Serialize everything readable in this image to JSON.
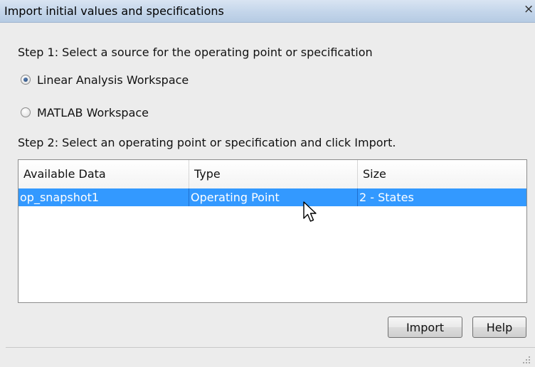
{
  "window": {
    "title": "Import initial values and specifications",
    "close_glyph": "×"
  },
  "step1": {
    "label": "Step 1: Select a source for the operating point or specification",
    "options": [
      {
        "label": "Linear Analysis Workspace",
        "selected": true
      },
      {
        "label": "MATLAB Workspace",
        "selected": false
      }
    ]
  },
  "step2": {
    "label": "Step 2: Select an operating point or specification and click Import."
  },
  "table": {
    "columns": [
      "Available Data",
      "Type",
      "Size"
    ],
    "rows": [
      {
        "data": "op_snapshot1",
        "type": "Operating Point",
        "size": "2 - States",
        "selected": true
      }
    ],
    "selection_color": "#3399ff"
  },
  "buttons": {
    "import": "Import",
    "help": "Help"
  },
  "icons": {
    "close": "close-icon",
    "radio": "radio-icon",
    "cursor": "mouse-pointer-icon",
    "grip": "resize-grip-icon"
  }
}
